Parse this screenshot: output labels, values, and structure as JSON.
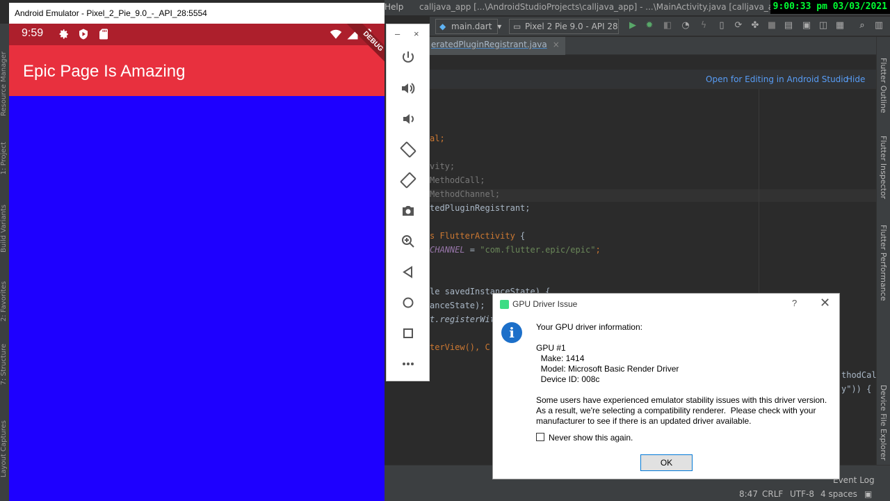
{
  "ide": {
    "menu_help": "Help",
    "path": "calljava_app [...\\AndroidStudioProjects\\calljava_app] - ...\\MainActivity.java [calljava_app_android]",
    "clock": "9:00:33 pm 03/03/2021",
    "toolbar": {
      "run_config": "main.dart",
      "device": "Pixel 2 Pie 9.0 - API 28"
    },
    "tab": {
      "label": "eratedPluginRegistrant.java",
      "close": "×"
    },
    "banner": {
      "open_label": "Open for Editing in Android Studio",
      "hide_label": "Hide"
    },
    "code": [
      {
        "text": "al;",
        "style": "kw"
      },
      {
        "text": "vity;",
        "style": "dim"
      },
      {
        "text": "MethodCall;",
        "style": "dim"
      },
      {
        "text": "MethodChannel;",
        "style": "dim"
      },
      {
        "text": "tedPluginRegistrant;",
        "style": "cls"
      },
      {
        "text_kw": "s ",
        "text_cls": "FlutterActivity",
        "text_rest": " {"
      },
      {
        "text_ital": "CHANNEL",
        "text_rest": " = ",
        "text_str": "\"com.flutter.epic/epic\"",
        "text_end": ";"
      },
      {
        "text": "le savedInstanceState) {",
        "style": "cls"
      },
      {
        "text": "anceState);",
        "style": "cls"
      },
      {
        "text": "t.registerWit",
        "style": "ital-cls"
      },
      {
        "text": "terView(), C",
        "style": "kw"
      },
      {
        "text": "thodCall",
        "style": "cls"
      },
      {
        "text": "y\")) {",
        "style": "cls"
      }
    ],
    "right_tools": [
      "Flutter Outline",
      "Flutter Inspector",
      "Flutter Performance",
      "Device File Explorer"
    ],
    "left_tools": [
      "Resource Manager",
      "1: Project",
      "Build Variants",
      "2: Favorites",
      "7: Structure",
      "Layout Captures"
    ],
    "statusbar": {
      "event_log": "Event Log",
      "position": "8:47",
      "line_sep": "CRLF",
      "encoding": "UTF-8",
      "indent": "4 spaces"
    }
  },
  "emulator": {
    "window_title": "Android Emulator - Pixel_2_Pie_9.0_-_API_28:5554",
    "status_time": "9:59",
    "debug_label": "DEBUG",
    "app_title": "Epic Page Is Amazing",
    "colors": {
      "status_bar": "#ad1f2c",
      "app_bar": "#e8303e",
      "body": "#1e00ff"
    },
    "toolbar_controls": {
      "minimize": "–",
      "close": "×"
    },
    "tools": [
      "power-icon",
      "volume-up-icon",
      "volume-down-icon",
      "rotate-left-icon",
      "rotate-right-icon",
      "camera-icon",
      "zoom-icon",
      "back-icon",
      "home-icon",
      "overview-icon",
      "more-icon"
    ]
  },
  "dialog": {
    "title": "GPU Driver Issue",
    "help": "?",
    "close": "✕",
    "info": "i",
    "heading": "Your GPU driver information:",
    "gpu": "GPU #1",
    "make": "  Make: 1414",
    "model": "  Model: Microsoft Basic Render Driver",
    "device": "  Device ID: 008c",
    "message_1": "Some users have experienced emulator stability issues with this driver version.",
    "message_2": "As a result, we're selecting a compatibility renderer.  Please check with your",
    "message_3": "manufacturer to see if there is an updated driver available.",
    "checkbox_label": "Never show this again.",
    "checkbox_checked": false,
    "ok_label": "OK"
  }
}
